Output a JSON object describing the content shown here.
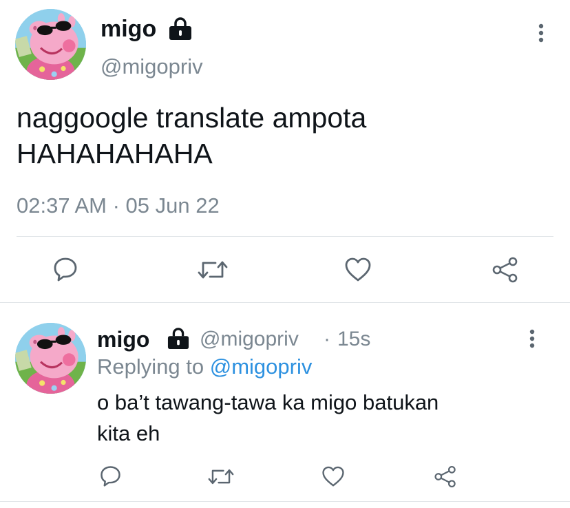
{
  "main_tweet": {
    "author_name": "migo",
    "handle": "@migopriv",
    "text_line1": "naggoogle translate ampota",
    "text_line2": "HAHAHAHAHA",
    "timestamp": "02:37 AM · 05 Jun 22",
    "avatar_icon": "peppa-pig-sunglasses-avatar",
    "actions": [
      "reply-icon",
      "retweet-icon",
      "like-icon",
      "share-icon"
    ]
  },
  "reply_tweet": {
    "author_name": "migo",
    "handle": "@migopriv",
    "separator": "·",
    "time_ago": "15s",
    "replying_label": "Replying to",
    "replying_handle": "@migopriv",
    "text_line1": "o ba’t tawang-tawa ka migo batukan",
    "text_line2": "kita eh",
    "avatar_icon": "peppa-pig-sunglasses-avatar",
    "actions": [
      "reply-icon",
      "retweet-icon",
      "like-icon",
      "share-icon"
    ]
  },
  "colors": {
    "text": "#0f1419",
    "muted": "#7b8791",
    "link": "#2d91e0",
    "divider": "#e1e5e8"
  }
}
